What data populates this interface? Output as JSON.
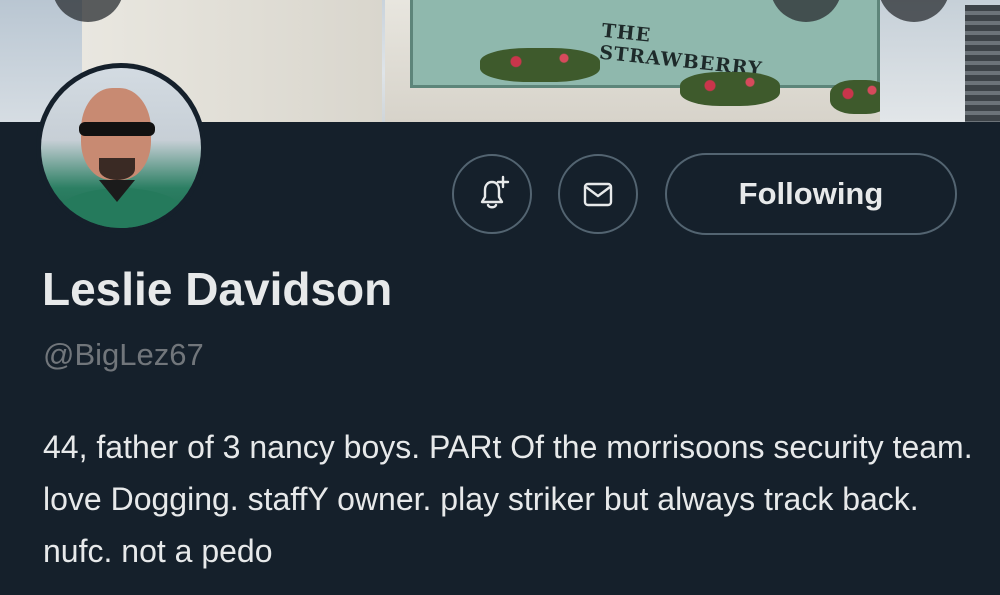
{
  "banner": {
    "sign_text": "THE STRAWBERRY"
  },
  "profile": {
    "display_name": "Leslie Davidson",
    "handle": "@BigLez67",
    "bio": "44, father of 3 nancy boys. PARt Of the morrisoons security team. love Dogging. staffY owner. play striker but always track back. nufc. not a pedo"
  },
  "actions": {
    "follow_label": "Following",
    "notify_icon": "bell-plus-icon",
    "message_icon": "envelope-icon"
  },
  "colors": {
    "background": "#15202b",
    "text_primary": "#e7e9ea",
    "text_secondary": "#71767b",
    "border": "#536471"
  }
}
